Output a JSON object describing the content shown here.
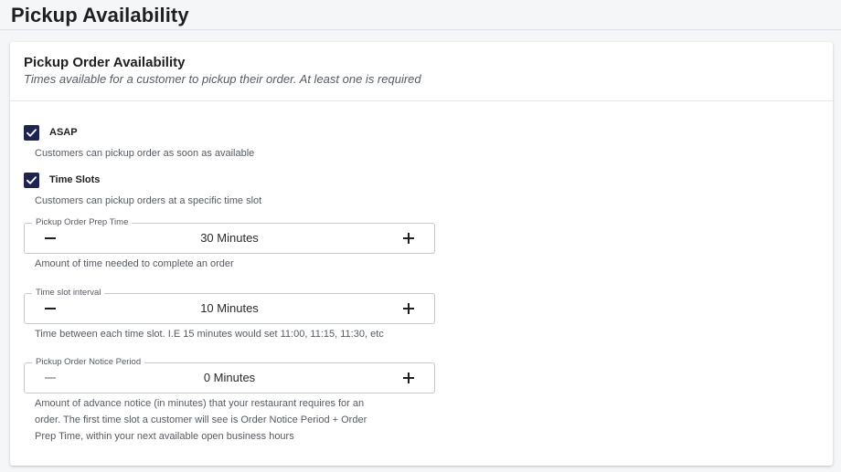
{
  "page": {
    "title": "Pickup Availability"
  },
  "card": {
    "title": "Pickup Order Availability",
    "subtitle": "Times available for a customer to pickup their order. At least one is required"
  },
  "options": [
    {
      "label": "ASAP",
      "checked": true,
      "helper": "Customers can pickup order as soon as available"
    },
    {
      "label": "Time Slots",
      "checked": true,
      "helper": "Customers can pickup orders at a specific time slot"
    }
  ],
  "steppers": [
    {
      "legend": "Pickup Order Prep Time",
      "value": "30 Minutes",
      "minus_enabled": true,
      "helper": "Amount of time needed to complete an order"
    },
    {
      "legend": "Time slot interval",
      "value": "10 Minutes",
      "minus_enabled": true,
      "helper": "Time between each time slot. I.E 15 minutes would set 11:00, 11:15, 11:30, etc"
    },
    {
      "legend": "Pickup Order Notice Period",
      "value": "0 Minutes",
      "minus_enabled": false,
      "helper_lines": [
        "Amount of advance notice (in minutes) that your restaurant requires for an",
        "order. The first time slot a customer will see is Order Notice Period + Order",
        "Prep Time, within your next available open business hours"
      ]
    }
  ],
  "colors": {
    "checkbox": "#1d2452",
    "icon_active": "#1f1f1f",
    "icon_disabled": "#b0b3b8"
  },
  "icons": {
    "checked": "check-icon",
    "decrement": "minus-icon",
    "increment": "plus-icon"
  }
}
